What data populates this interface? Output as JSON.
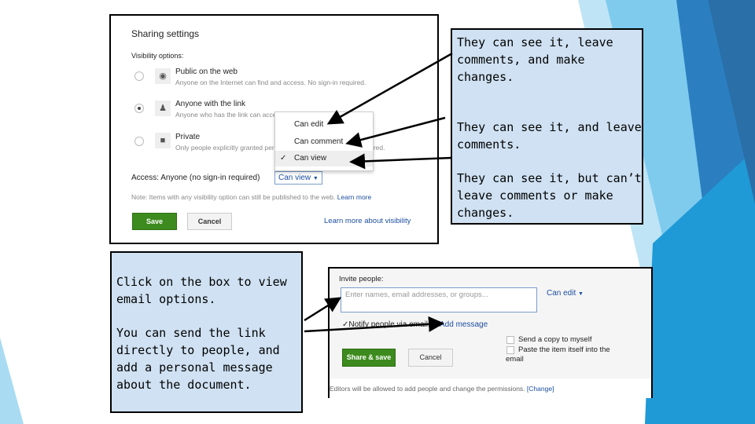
{
  "sharing_settings": {
    "title": "Sharing settings",
    "visibility_label": "Visibility options:",
    "options": [
      {
        "label": "Public on the web",
        "description": "Anyone on the Internet can find and access. No sign-in required.",
        "icon": "globe-icon",
        "selected": false
      },
      {
        "label": "Anyone with the link",
        "description": "Anyone who has the link can access. No sign-in required.",
        "icon": "person-icon",
        "selected": true
      },
      {
        "label": "Private",
        "description": "Only people explicitly granted permission can access. Sign-in required.",
        "icon": "lock-icon",
        "selected": false
      }
    ],
    "dropdown_menu": [
      {
        "label": "Can edit",
        "checked": false
      },
      {
        "label": "Can comment",
        "checked": false
      },
      {
        "label": "Can view",
        "checked": true
      }
    ],
    "access_label": "Access:  Anyone (no sign-in required)",
    "access_value": "Can view",
    "note": "Note: Items with any visibility option can still be published to the web.",
    "note_link": "Learn more",
    "save": "Save",
    "cancel": "Cancel",
    "learn_more": "Learn more about visibility"
  },
  "callout_permissions": [
    "They can see it, leave comments, and make changes.",
    "They can see it, and leave comments.",
    "They can see it, but can’t leave comments or make changes."
  ],
  "callout_invite": [
    "Click on the box to view email options.",
    "You can send the link directly to people, and add a personal message about the document."
  ],
  "invite": {
    "label": "Invite people:",
    "placeholder": "Enter names, email addresses, or groups...",
    "permission": "Can edit",
    "notify": "Notify people via email",
    "notify_checked": true,
    "add_message": "Add message",
    "send_copy": "Send a copy to myself",
    "paste_item": "Paste the item itself into the email",
    "share_save": "Share & save",
    "cancel": "Cancel",
    "footer": "Editors will be allowed to add people and change the permissions.",
    "footer_link": "[Change]"
  },
  "colors": {
    "accent_green": "#3d8b1e",
    "callout_fill": "#cfe1f2",
    "link_blue": "#1d4fa0",
    "deco_blue": "#1f9ad6"
  }
}
